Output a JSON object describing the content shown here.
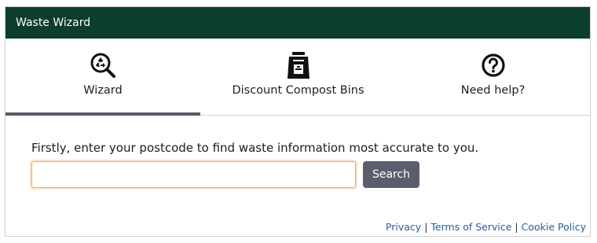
{
  "header": {
    "title": "Waste Wizard"
  },
  "tabs": [
    {
      "label": "Wizard",
      "icon": "recycle-search-icon",
      "active": true
    },
    {
      "label": "Discount Compost Bins",
      "icon": "compost-bin-icon",
      "active": false
    },
    {
      "label": "Need help?",
      "icon": "question-circle-icon",
      "active": false
    }
  ],
  "main": {
    "prompt": "Firstly, enter your postcode to find waste information most accurate to you.",
    "postcode_value": "",
    "search_label": "Search"
  },
  "footer": {
    "links": [
      "Privacy",
      "Terms of Service",
      "Cookie Policy"
    ],
    "separator": "|"
  },
  "colors": {
    "header_bg": "#0c3d2e",
    "active_tab_indicator": "#555a68",
    "search_button_bg": "#5a5f6e",
    "input_focus_border": "#f0a860",
    "link": "#2a5c9a"
  }
}
